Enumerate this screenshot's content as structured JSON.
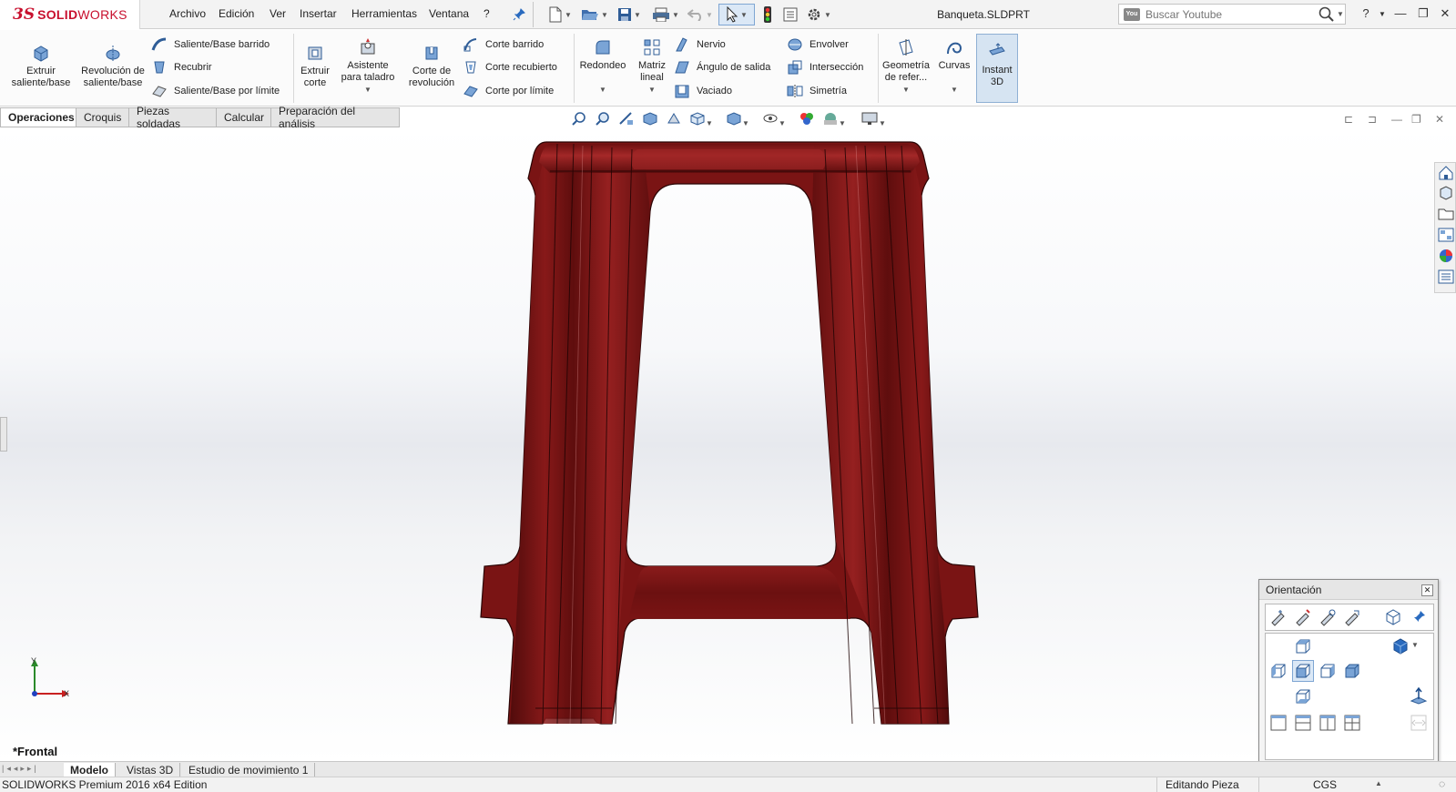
{
  "app": {
    "logo_ds": "3S",
    "logo_brand_bold": "SOLID",
    "logo_brand_light": "WORKS",
    "document_title": "Banqueta.SLDPRT"
  },
  "menu": [
    "Archivo",
    "Edición",
    "Ver",
    "Insertar",
    "Herramientas",
    "Ventana",
    "?"
  ],
  "search": {
    "placeholder": "Buscar Youtube",
    "badge": "You"
  },
  "ribbon": {
    "extrude_boss": "Extruir saliente/base",
    "revolve_boss": "Revolución de saliente/base",
    "swept_boss": "Saliente/Base barrido",
    "lofted_boss": "Recubrir",
    "boundary_boss": "Saliente/Base por límite",
    "extruded_cut": "Extruir corte",
    "hole_wizard": "Asistente para taladro",
    "revolved_cut": "Corte de revolución",
    "swept_cut": "Corte barrido",
    "lofted_cut": "Corte recubierto",
    "boundary_cut": "Corte por límite",
    "fillet": "Redondeo",
    "linear_pattern": "Matriz lineal",
    "rib": "Nervio",
    "draft": "Ángulo de salida",
    "shell": "Vaciado",
    "wrap": "Envolver",
    "intersect": "Intersección",
    "mirror": "Simetría",
    "ref_geometry": "Geometría de refer...",
    "curves": "Curvas",
    "instant3d": "Instant 3D"
  },
  "tabs": [
    "Operaciones",
    "Croquis",
    "Piezas soldadas",
    "Calcular",
    "Preparación del análisis"
  ],
  "viewport": {
    "view_label": "*Frontal",
    "triad_y": "Y",
    "triad_x": "X",
    "part_color": "#7a1414"
  },
  "orientation": {
    "title": "Orientación"
  },
  "bottom_tabs": [
    "Modelo",
    "Vistas 3D",
    "Estudio de movimiento 1"
  ],
  "status": {
    "edition": "SOLIDWORKS Premium 2016 x64 Edition",
    "mode": "Editando Pieza",
    "units": "CGS"
  }
}
